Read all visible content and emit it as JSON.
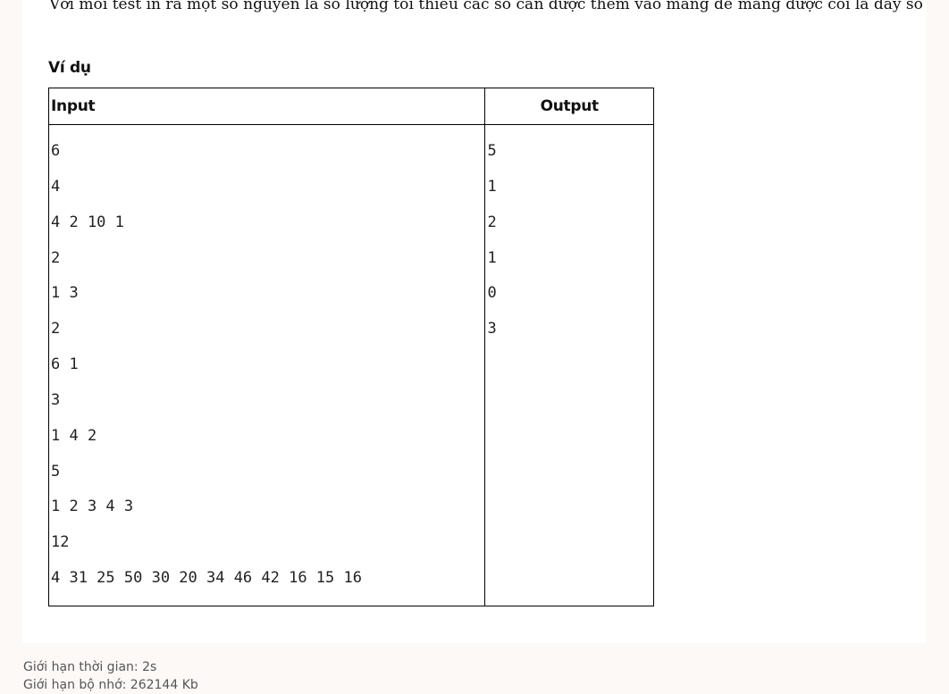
{
  "problem": {
    "intro_text": "Với mỗi test in ra một số nguyên là số lượng tối thiểu các số cần được thêm vào mảng để mảng được coi là dãy số đẹp.",
    "example_heading": "Ví dụ",
    "table": {
      "input_header": "Input",
      "output_header": "Output",
      "input_lines": [
        "6",
        "4",
        "4 2 10 1",
        "2",
        "1 3",
        "2",
        "6 1",
        "3",
        "1 4 2",
        "5",
        "1 2 3 4 3",
        "12",
        "4 31 25 50 30 20 34 46 42 16 15 16"
      ],
      "output_lines": [
        "5",
        "1",
        "2",
        "1",
        "0",
        "3"
      ]
    }
  },
  "limits": {
    "time_limit": "Giới hạn thời gian: 2s",
    "memory_limit": "Giới hạn bộ nhớ: 262144 Kb"
  }
}
